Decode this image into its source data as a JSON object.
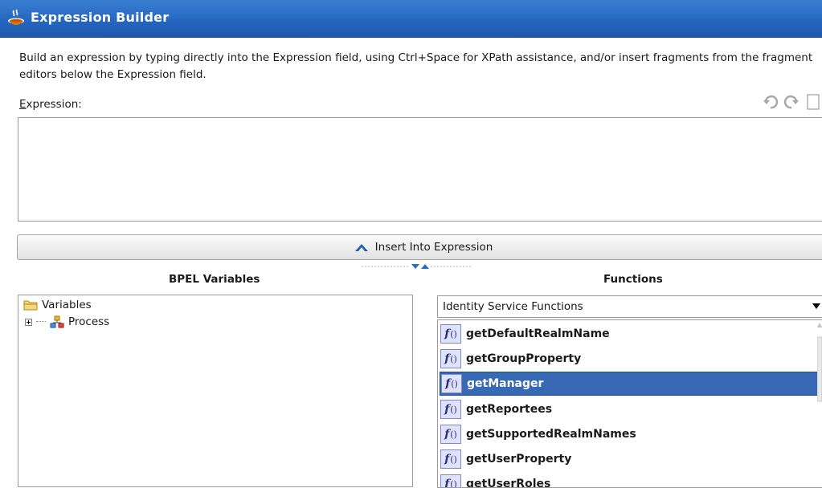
{
  "window": {
    "title": "Expression Builder"
  },
  "description": "Build an expression by typing directly into the Expression field, using Ctrl+Space for XPath assistance, and/or insert fragments from the fragment editors below the Expression field.",
  "expression": {
    "label_mnemonic": "E",
    "label_rest": "xpression:",
    "value": ""
  },
  "toolbar": {
    "icons": [
      "undo-icon",
      "redo-icon",
      "clear-icon"
    ]
  },
  "insert_button": {
    "label": "Insert Into Expression",
    "icon": "up-arrow-icon"
  },
  "bpel_variables": {
    "title": "BPEL Variables",
    "tree": [
      {
        "label": "Variables",
        "icon": "folder-icon"
      },
      {
        "label": "Process",
        "icon": "process-icon"
      }
    ]
  },
  "functions": {
    "title": "Functions",
    "category": "Identity Service Functions",
    "items": [
      {
        "label": "getDefaultRealmName"
      },
      {
        "label": "getGroupProperty"
      },
      {
        "label": "getManager"
      },
      {
        "label": "getReportees"
      },
      {
        "label": "getSupportedRealmNames"
      },
      {
        "label": "getUserProperty"
      },
      {
        "label": "getUserRoles"
      }
    ],
    "selected_index": 2
  },
  "colors": {
    "titlebar": "#2666c0",
    "selection": "#3869b5",
    "function_icon_bg": "#dfe2fb"
  }
}
